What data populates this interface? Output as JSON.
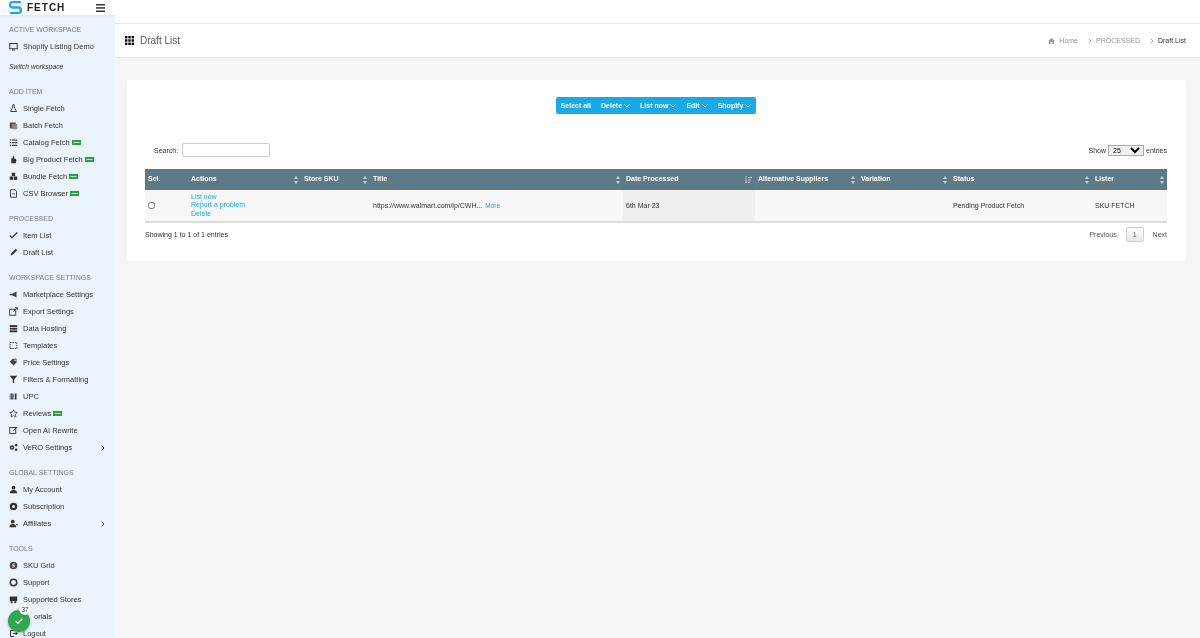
{
  "sidebar": {
    "logo": "FETCH",
    "sections": [
      {
        "heading": "ACTIVE WORKSPACE",
        "items": [
          {
            "label": "Shopify Listing Demo",
            "pro": false,
            "submenu": false
          }
        ],
        "note": "Switch workspace"
      },
      {
        "heading": "ADD ITEM",
        "items": [
          {
            "label": "Single Fetch",
            "pro": false,
            "submenu": false
          },
          {
            "label": "Batch Fetch",
            "pro": false,
            "submenu": false
          },
          {
            "label": "Catalog Fetch",
            "pro": true,
            "submenu": false
          },
          {
            "label": "Big Product Fetch",
            "pro": true,
            "submenu": false
          },
          {
            "label": "Bundle Fetch",
            "pro": true,
            "submenu": false
          },
          {
            "label": "CSV Browser",
            "pro": true,
            "submenu": false
          }
        ]
      },
      {
        "heading": "PROCESSED",
        "items": [
          {
            "label": "Item List",
            "pro": false,
            "submenu": false
          },
          {
            "label": "Draft List",
            "pro": false,
            "submenu": false
          }
        ]
      },
      {
        "heading": "WORKSPACE SETTINGS",
        "items": [
          {
            "label": "Marketplace Settings",
            "pro": false,
            "submenu": false
          },
          {
            "label": "Export Settings",
            "pro": false,
            "submenu": false
          },
          {
            "label": "Data Hosting",
            "pro": false,
            "submenu": false
          },
          {
            "label": "Templates",
            "pro": false,
            "submenu": false
          },
          {
            "label": "Price Settings",
            "pro": false,
            "submenu": false
          },
          {
            "label": "Filters & Formatting",
            "pro": false,
            "submenu": false
          },
          {
            "label": "UPC",
            "pro": false,
            "submenu": false
          },
          {
            "label": "Reviews",
            "pro": true,
            "submenu": false
          },
          {
            "label": "Open AI Rewrite",
            "pro": false,
            "submenu": false
          },
          {
            "label": "VeRO Settings",
            "pro": false,
            "submenu": true
          }
        ]
      },
      {
        "heading": "GLOBAL SETTINGS",
        "items": [
          {
            "label": "My Account",
            "pro": false,
            "submenu": false
          },
          {
            "label": "Subscription",
            "pro": false,
            "submenu": false
          },
          {
            "label": "Affiliates",
            "pro": false,
            "submenu": true
          }
        ]
      },
      {
        "heading": "TOOLS",
        "items": [
          {
            "label": "SKU Grid",
            "pro": false,
            "submenu": false
          },
          {
            "label": "Support",
            "pro": false,
            "submenu": false
          },
          {
            "label": "Supported Stores",
            "pro": false,
            "submenu": false
          },
          {
            "label": "orials",
            "pro": false,
            "submenu": false
          },
          {
            "label": "Logout",
            "pro": false,
            "submenu": false
          }
        ]
      }
    ]
  },
  "page_header": {
    "title": "Draft List",
    "breadcrumb": [
      "Home",
      "PROCESSED",
      "Draft List"
    ]
  },
  "toolbar": [
    {
      "label": "Select all",
      "dropdown": false
    },
    {
      "label": "Delete",
      "dropdown": true
    },
    {
      "label": "List now",
      "dropdown": true
    },
    {
      "label": "Edit",
      "dropdown": true
    },
    {
      "label": "Shopify",
      "dropdown": true
    }
  ],
  "search": {
    "label": "Search:"
  },
  "page_length": {
    "before": "Show",
    "value": "25",
    "after": "entries"
  },
  "table": {
    "columns": [
      {
        "label": "Sel.",
        "sortable": false,
        "sorted": false
      },
      {
        "label": "Actions",
        "sortable": true,
        "sorted": false
      },
      {
        "label": "Store SKU",
        "sortable": true,
        "sorted": false
      },
      {
        "label": "Title",
        "sortable": true,
        "sorted": false
      },
      {
        "label": "Date Processed",
        "sortable": true,
        "sorted": true
      },
      {
        "label": "Alternative Suppliers",
        "sortable": true,
        "sorted": false
      },
      {
        "label": "Variation",
        "sortable": true,
        "sorted": false
      },
      {
        "label": "Status",
        "sortable": true,
        "sorted": false
      },
      {
        "label": "Lister",
        "sortable": true,
        "sorted": false
      }
    ],
    "rows": [
      {
        "checked": false,
        "actions": [
          "List now",
          "Report a problem",
          "Delete"
        ],
        "title": "https://www.walmart.com/ip/CWH...",
        "more": "More",
        "date_processed": "6th Mar 23",
        "status": "Pending Product Fetch",
        "lister": "SKU FETCH"
      }
    ]
  },
  "info": "Showing 1 to 1 of 1 entries",
  "pagination": {
    "previous": "Previous",
    "pages": [
      {
        "label": "1",
        "selected": true
      }
    ],
    "next": "Next"
  },
  "help_badge": {
    "count": "37"
  }
}
